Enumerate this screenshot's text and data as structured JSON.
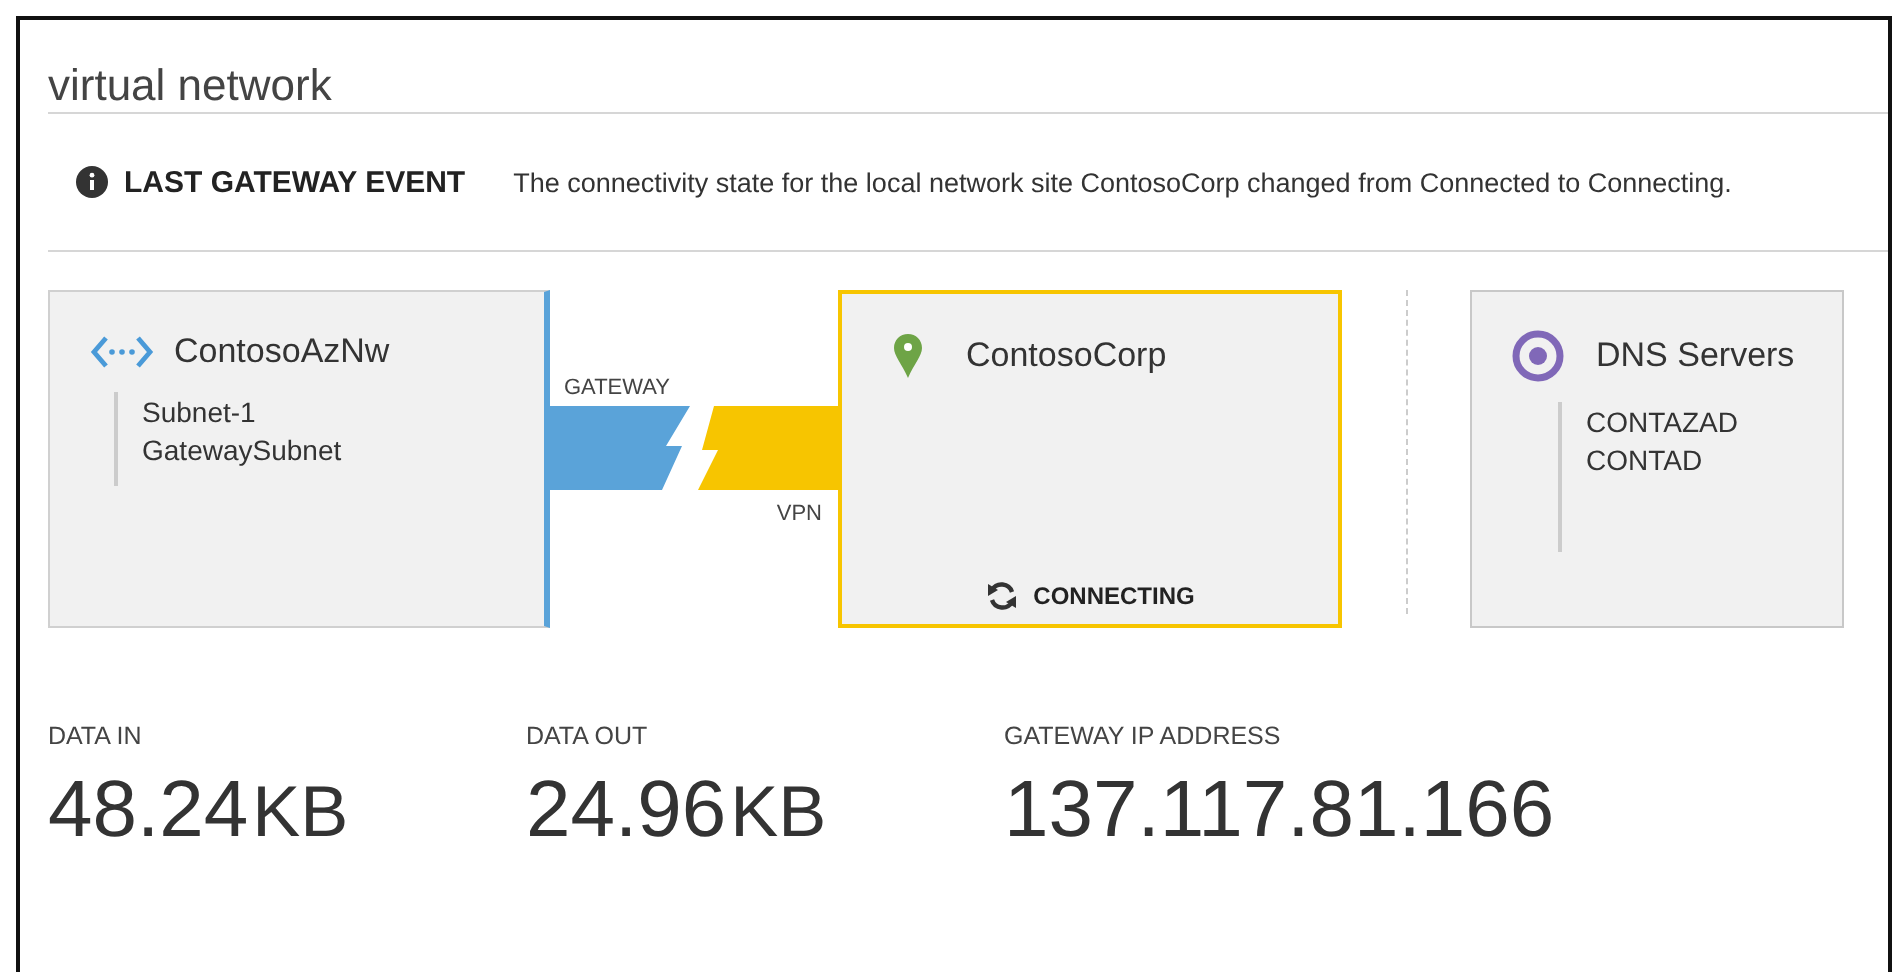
{
  "title": "virtual network",
  "event": {
    "label": "LAST GATEWAY EVENT",
    "message": "The connectivity state for the local network site ContosoCorp changed from Connected to Connecting."
  },
  "virtual_network": {
    "name": "ContosoAzNw",
    "subnets": [
      "Subnet-1",
      "GatewaySubnet"
    ]
  },
  "connection": {
    "gateway_label": "GATEWAY",
    "vpn_label": "VPN"
  },
  "local_site": {
    "name": "ContosoCorp",
    "status": "CONNECTING",
    "connecting": true
  },
  "dns": {
    "title": "DNS Servers",
    "servers": [
      "CONTAZAD",
      "CONTAD"
    ]
  },
  "stats": [
    {
      "label": "DATA IN",
      "value": "48.24",
      "unit": "KB"
    },
    {
      "label": "DATA OUT",
      "value": "24.96",
      "unit": "KB"
    },
    {
      "label": "GATEWAY IP ADDRESS",
      "value": "137.117.81.166"
    }
  ]
}
